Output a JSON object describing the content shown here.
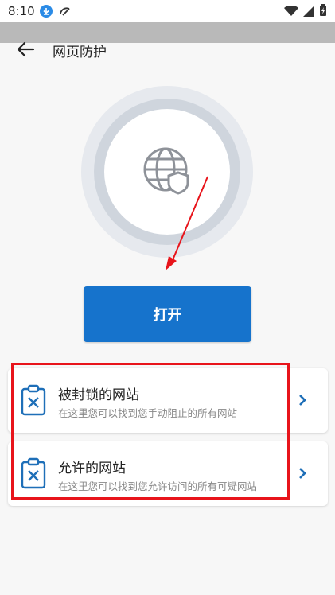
{
  "status": {
    "time": "8:10"
  },
  "header": {
    "title": "网页防护"
  },
  "action": {
    "open_label": "打开"
  },
  "cards": [
    {
      "title": "被封锁的网站",
      "subtitle": "在这里您可以找到您手动阻止的所有网站"
    },
    {
      "title": "允许的网站",
      "subtitle": "在这里您可以找到您允许访问的所有可疑网站"
    }
  ],
  "colors": {
    "accent": "#1673cc",
    "highlight": "#e8141b",
    "icon": "#1e6fb8"
  }
}
